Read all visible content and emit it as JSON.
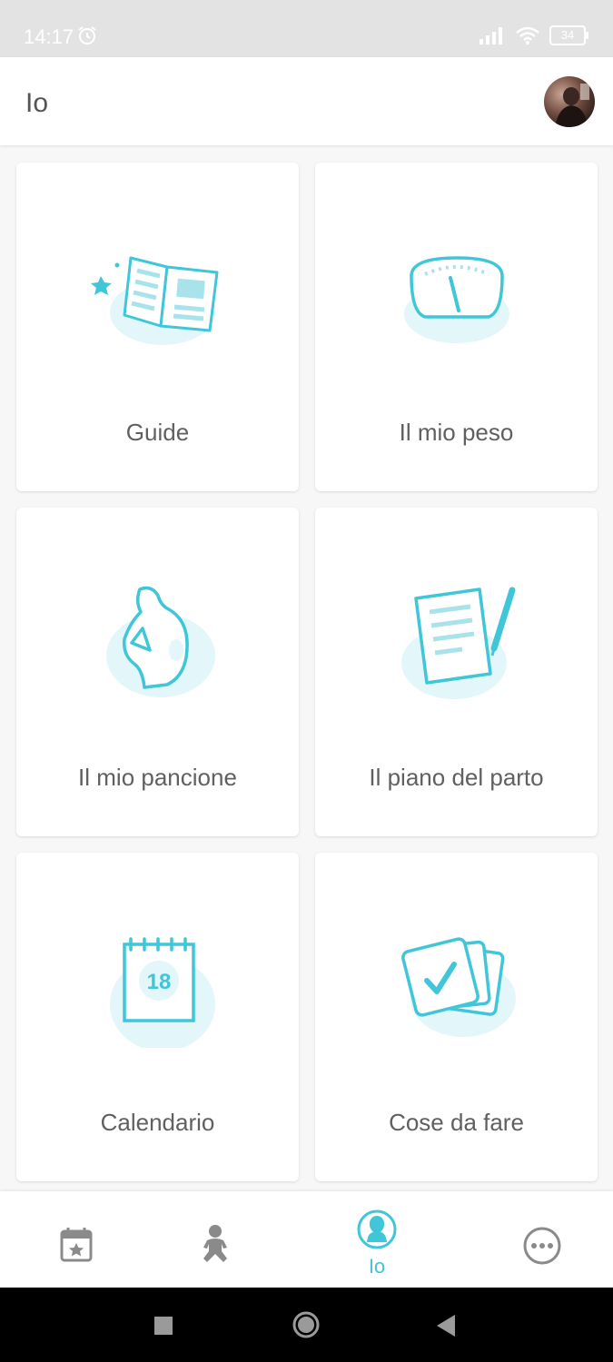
{
  "status_bar": {
    "time": "14:17",
    "battery": "34"
  },
  "header": {
    "title": "Io"
  },
  "cards": [
    {
      "label": "Guide",
      "icon": "book-icon"
    },
    {
      "label": "Il mio peso",
      "icon": "scale-icon"
    },
    {
      "label": "Il mio pancione",
      "icon": "belly-icon"
    },
    {
      "label": "Il piano del parto",
      "icon": "birth-plan-icon"
    },
    {
      "label": "Calendario",
      "icon": "calendar-icon",
      "date_number": "18"
    },
    {
      "label": "Cose da fare",
      "icon": "todo-cards-icon"
    }
  ],
  "bottom_nav": {
    "items": [
      {
        "icon": "calendar-star-icon",
        "label": ""
      },
      {
        "icon": "baby-icon",
        "label": ""
      },
      {
        "icon": "mother-profile-icon",
        "label": "Io",
        "active": true
      },
      {
        "icon": "more-icon",
        "label": ""
      }
    ]
  },
  "colors": {
    "accent": "#3fc6d8",
    "accent_light": "#e3f6f9",
    "text": "#606060",
    "inactive_icon": "#8a8a8a"
  }
}
